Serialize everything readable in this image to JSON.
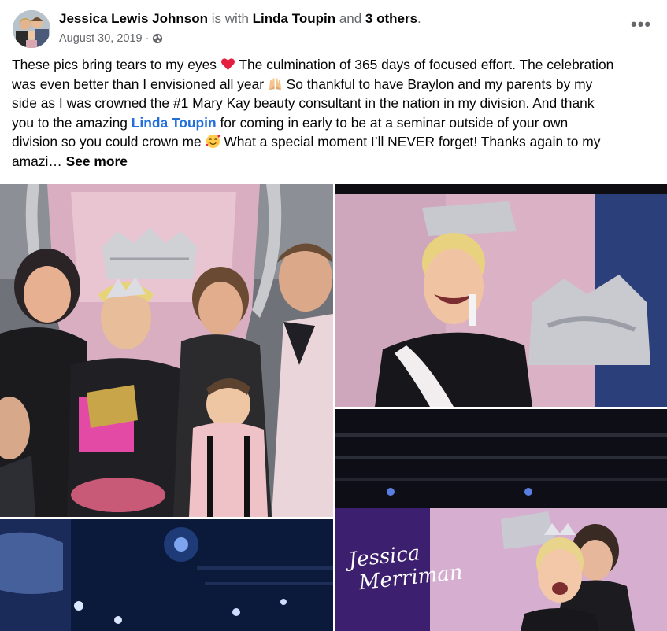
{
  "post": {
    "author": "Jessica Lewis Johnson",
    "with_text": " is with ",
    "tagged": "Linda Toupin",
    "and_text": " and ",
    "others": "3 others",
    "period": ".",
    "date": "August 30, 2019",
    "separator": "·",
    "privacy_icon": "globe-icon",
    "menu_icon": "more-options-icon",
    "more_glyph": "•••",
    "text_lines": {
      "l1a": "These pics bring tears to my eyes",
      "l1b": " The culmination of 365 days of focused effort. The celebration",
      "l2a": "was even better than I envisioned all year",
      "l2b": " So thankful to have Braylon and my parents by my",
      "l3": "side as I was crowned the #1 Mary Kay beauty consultant in the nation in my division. And thank",
      "l4a": "you to the amazing ",
      "l4mention": "Linda Toupin",
      "l4b": " for coming in early to be at a seminar outside of your own",
      "l5a": "division so you could crown me",
      "l5b": " What a special moment I’ll NEVER forget! Thanks again to my",
      "l6": "amazi… ",
      "see_more": "See more"
    },
    "emojis": [
      "red-heart-emoji",
      "raising-hands-emoji",
      "smiling-face-with-hearts-emoji"
    ]
  },
  "photos": {
    "screen_caption_line1": "Jessica",
    "screen_caption_line2": "Merriman"
  },
  "colors": {
    "link": "#216fdb",
    "muted": "#65676b",
    "text": "#050505"
  }
}
